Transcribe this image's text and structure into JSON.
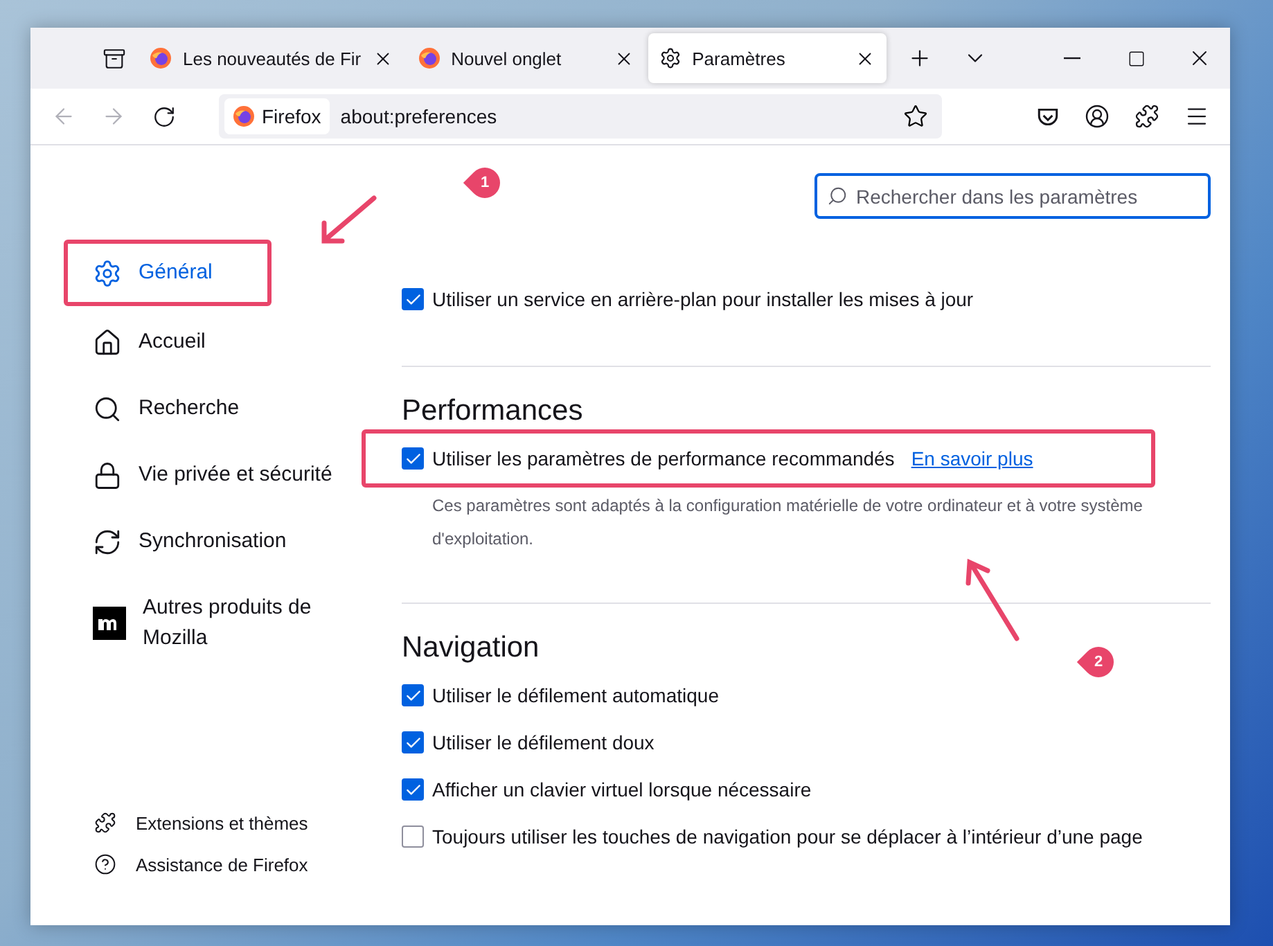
{
  "tabs": [
    {
      "title": "Les nouveautés de Fir",
      "selected": false
    },
    {
      "title": "Nouvel onglet",
      "selected": false
    },
    {
      "title": "Paramètres",
      "selected": true
    }
  ],
  "address": {
    "identity": "Firefox",
    "url": "about:preferences"
  },
  "search": {
    "placeholder": "Rechercher dans les paramètres"
  },
  "sidebar": {
    "items": [
      {
        "label": "Général",
        "selected": true,
        "highlighted": true
      },
      {
        "label": "Accueil",
        "selected": false,
        "highlighted": false
      },
      {
        "label": "Recherche",
        "selected": false,
        "highlighted": false
      },
      {
        "label": "Vie privée et sécurité",
        "selected": false,
        "highlighted": false
      },
      {
        "label": "Synchronisation",
        "selected": false,
        "highlighted": false
      },
      {
        "label": "Autres produits de Mozilla",
        "selected": false,
        "highlighted": false
      }
    ],
    "footer": [
      {
        "label": "Extensions et thèmes"
      },
      {
        "label": "Assistance de Firefox"
      }
    ]
  },
  "sections": [
    {
      "options": [
        {
          "label": "Utiliser un service en arrière-plan pour installer les mises à jour",
          "checked": true,
          "highlighted": false
        }
      ]
    },
    {
      "heading": "Performances",
      "options": [
        {
          "label": "Utiliser les paramètres de performance recommandés",
          "checked": true,
          "highlighted": true,
          "link": "En savoir plus",
          "description": "Ces paramètres sont adaptés à la configuration matérielle de votre ordinateur et à votre système d'exploitation."
        }
      ]
    },
    {
      "heading": "Navigation",
      "options": [
        {
          "label": "Utiliser le défilement automatique",
          "checked": true,
          "highlighted": false
        },
        {
          "label": "Utiliser le défilement doux",
          "checked": true,
          "highlighted": false
        },
        {
          "label": "Afficher un clavier virtuel lorsque nécessaire",
          "checked": true,
          "highlighted": false
        },
        {
          "label": "Toujours utiliser les touches de navigation pour se déplacer à l’intérieur d’une page",
          "checked": false,
          "highlighted": false
        }
      ]
    }
  ],
  "annotations": [
    {
      "label": "1"
    },
    {
      "label": "2"
    }
  ]
}
